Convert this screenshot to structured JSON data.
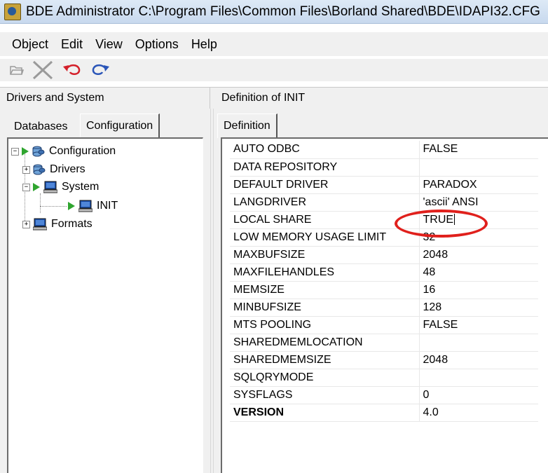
{
  "window": {
    "title": "BDE Administrator  C:\\Program Files\\Common Files\\Borland Shared\\BDE\\IDAPI32.CFG"
  },
  "menu": {
    "items": [
      "Object",
      "Edit",
      "View",
      "Options",
      "Help"
    ]
  },
  "toolbar": {
    "icons": [
      "open-folder-icon",
      "delete-icon",
      "undo-icon",
      "redo-icon"
    ]
  },
  "left_panel": {
    "header": "Drivers and System",
    "tabs": [
      "Databases",
      "Configuration"
    ],
    "active_tab": "Configuration",
    "tree": {
      "configuration": "Configuration",
      "drivers": "Drivers",
      "system": "System",
      "init": "INIT",
      "formats": "Formats"
    }
  },
  "right_panel": {
    "header": "Definition of INIT",
    "tab": "Definition",
    "rows": [
      {
        "key": "AUTO ODBC",
        "value": "FALSE"
      },
      {
        "key": "DATA REPOSITORY",
        "value": ""
      },
      {
        "key": "DEFAULT DRIVER",
        "value": "PARADOX"
      },
      {
        "key": "LANGDRIVER",
        "value": "'ascii' ANSI"
      },
      {
        "key": "LOCAL SHARE",
        "value": "TRUE"
      },
      {
        "key": "LOW MEMORY USAGE LIMIT",
        "value": "32"
      },
      {
        "key": "MAXBUFSIZE",
        "value": "2048"
      },
      {
        "key": "MAXFILEHANDLES",
        "value": "48"
      },
      {
        "key": "MEMSIZE",
        "value": "16"
      },
      {
        "key": "MINBUFSIZE",
        "value": "128"
      },
      {
        "key": "MTS POOLING",
        "value": "FALSE"
      },
      {
        "key": "SHAREDMEMLOCATION",
        "value": ""
      },
      {
        "key": "SHAREDMEMSIZE",
        "value": "2048"
      },
      {
        "key": "SQLQRYMODE",
        "value": ""
      },
      {
        "key": "SYSFLAGS",
        "value": "0"
      },
      {
        "key": "VERSION",
        "value": "4.0"
      }
    ]
  },
  "annotation": {
    "highlight_color": "#e0201c"
  }
}
